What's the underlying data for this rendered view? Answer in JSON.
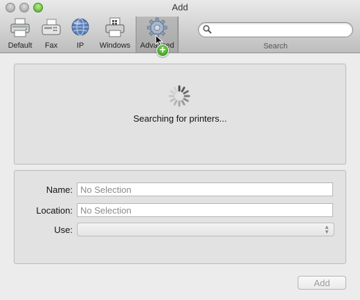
{
  "window": {
    "title": "Add"
  },
  "toolbar": {
    "items": [
      {
        "label": "Default",
        "icon": "printer-icon"
      },
      {
        "label": "Fax",
        "icon": "fax-icon"
      },
      {
        "label": "IP",
        "icon": "globe-icon"
      },
      {
        "label": "Windows",
        "icon": "windows-printer-icon"
      },
      {
        "label": "Advanced",
        "icon": "gear-icon",
        "selected": true
      }
    ],
    "search": {
      "value": "",
      "label": "Search"
    }
  },
  "results": {
    "status": "Searching for printers..."
  },
  "form": {
    "name_label": "Name:",
    "name_placeholder": "No Selection",
    "location_label": "Location:",
    "location_placeholder": "No Selection",
    "use_label": "Use:",
    "use_value": ""
  },
  "footer": {
    "add_label": "Add"
  },
  "colors": {
    "zoom_button": "#4fa328",
    "badge": "#2c8f14"
  }
}
